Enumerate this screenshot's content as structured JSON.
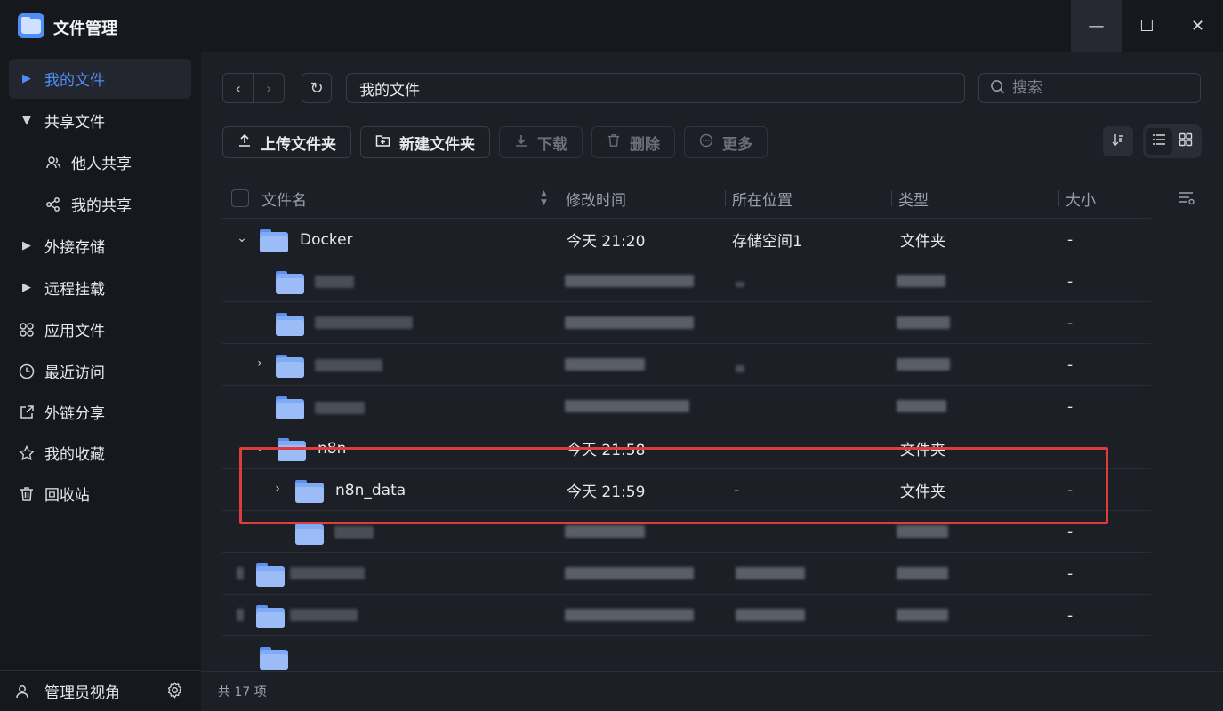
{
  "app": {
    "title": "文件管理"
  },
  "window": {
    "minimize": "—",
    "maximize": "☐",
    "close": "✕"
  },
  "sidebar": {
    "items": [
      {
        "label": "我的文件",
        "icon": "caret-right-icon"
      },
      {
        "label": "共享文件",
        "icon": "caret-down-icon"
      },
      {
        "label": "他人共享",
        "icon": "users-icon"
      },
      {
        "label": "我的共享",
        "icon": "share-icon"
      },
      {
        "label": "外接存储",
        "icon": "caret-right-icon"
      },
      {
        "label": "远程挂载",
        "icon": "caret-right-icon"
      },
      {
        "label": "应用文件",
        "icon": "apps-icon"
      },
      {
        "label": "最近访问",
        "icon": "clock-icon"
      },
      {
        "label": "外链分享",
        "icon": "external-link-icon"
      },
      {
        "label": "我的收藏",
        "icon": "star-icon"
      },
      {
        "label": "回收站",
        "icon": "trash-icon"
      }
    ],
    "bottom_label": "管理员视角"
  },
  "path": {
    "current": "我的文件"
  },
  "search": {
    "placeholder": "搜索"
  },
  "toolbar": {
    "upload": "上传文件夹",
    "new_folder": "新建文件夹",
    "download": "下载",
    "delete": "删除",
    "more": "更多"
  },
  "table": {
    "headers": {
      "name": "文件名",
      "modified": "修改时间",
      "location": "所在位置",
      "type": "类型",
      "size": "大小"
    },
    "rows": [
      {
        "name": "Docker",
        "modified": "今天 21:20",
        "location": "存储空间1",
        "type": "文件夹",
        "size": "-"
      },
      {
        "name": "",
        "modified": "",
        "location": "",
        "type": "",
        "size": "-"
      },
      {
        "name": "",
        "modified": "",
        "location": "",
        "type": "",
        "size": "-"
      },
      {
        "name": "",
        "modified": "",
        "location": "",
        "type": "",
        "size": "-"
      },
      {
        "name": "",
        "modified": "",
        "location": "",
        "type": "",
        "size": "-"
      },
      {
        "name": "n8n",
        "modified": "今天 21:58",
        "location": "-",
        "type": "文件夹",
        "size": "-"
      },
      {
        "name": "n8n_data",
        "modified": "今天 21:59",
        "location": "-",
        "type": "文件夹",
        "size": "-"
      },
      {
        "name": "",
        "modified": "",
        "location": "",
        "type": "",
        "size": "-"
      },
      {
        "name": "",
        "modified": "",
        "location": "",
        "type": "",
        "size": "-"
      },
      {
        "name": "",
        "modified": "",
        "location": "",
        "type": "",
        "size": "-"
      }
    ]
  },
  "footer": {
    "count": "共 17 项"
  },
  "colors": {
    "accent": "#4f8ef7",
    "highlight": "#e23b3b"
  }
}
